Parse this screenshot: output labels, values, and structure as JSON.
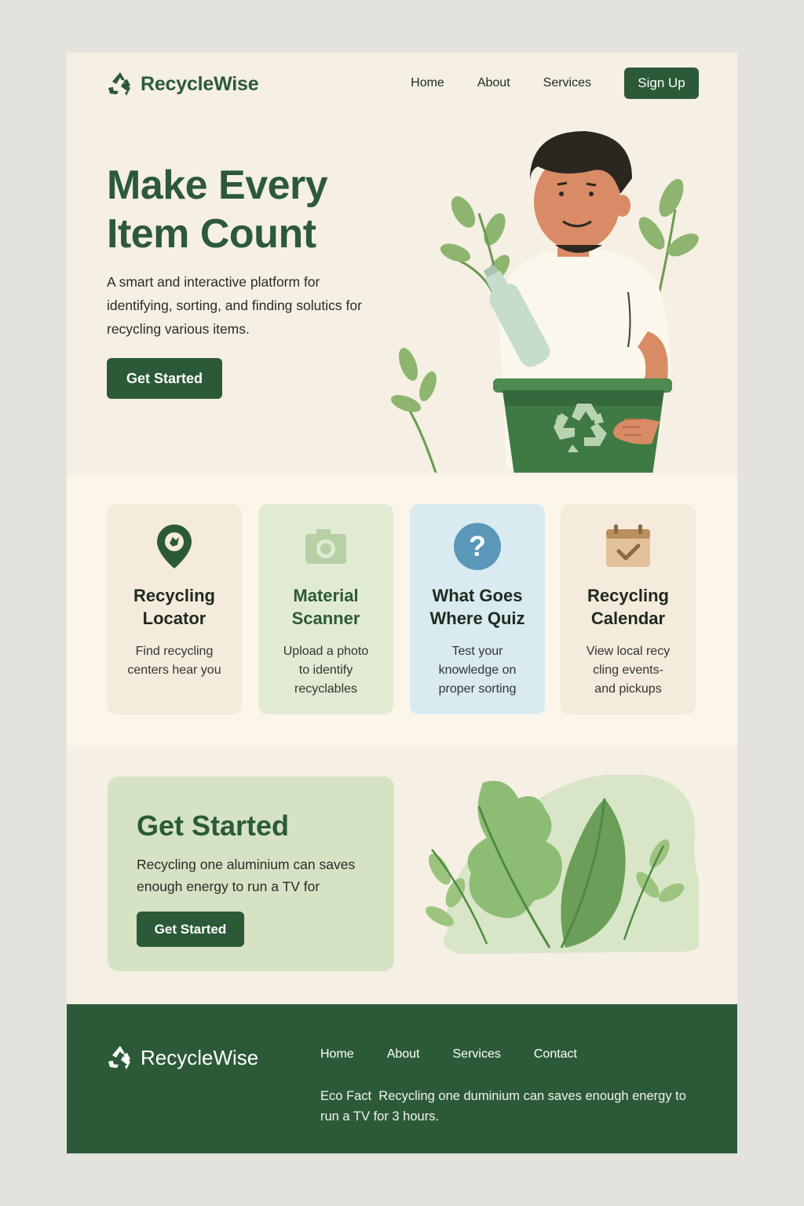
{
  "brand": {
    "name": "RecycleWise",
    "logo_icon": "recycle-icon",
    "primary_color": "#2c5a39"
  },
  "nav": {
    "items": [
      "Home",
      "About",
      "Services"
    ],
    "signup_label": "Sign Up"
  },
  "hero": {
    "title": "Make Every Item Count",
    "subtitle": "A smart and interactive platform for identifying, sorting, and finding solutics for recycling various items.",
    "button_label": "Get Started",
    "illustration": "person-holding-recycling-bin"
  },
  "features": [
    {
      "icon": "location-pin-icon",
      "title": "Recycling Locator",
      "desc": "Find recycling centers hear you",
      "color": "#f4ebdd"
    },
    {
      "icon": "camera-icon",
      "title": "Material Scanner",
      "desc": "Upload a photo to identify recyclables",
      "color": "#e1ebd3"
    },
    {
      "icon": "question-icon",
      "title": "What Goes Where Quiz",
      "desc": "Test your knowledge on proper sorting",
      "color": "#d9eaf0"
    },
    {
      "icon": "calendar-icon",
      "title": "Recycling Calendar",
      "desc": "View local recy cling events- and pickups",
      "color": "#f4ebdd"
    }
  ],
  "cta": {
    "title": "Get Started",
    "text": "Recycling one aluminium can saves enough energy to run a TV for",
    "button_label": "Get Started"
  },
  "footer": {
    "brand": "RecycleWise",
    "nav": [
      "Home",
      "About",
      "Services",
      "Contact"
    ],
    "eco_fact_label": "Eco Fact",
    "eco_fact_text": "Recycling one duminium can saves enough energy to run a TV for 3 hours."
  }
}
